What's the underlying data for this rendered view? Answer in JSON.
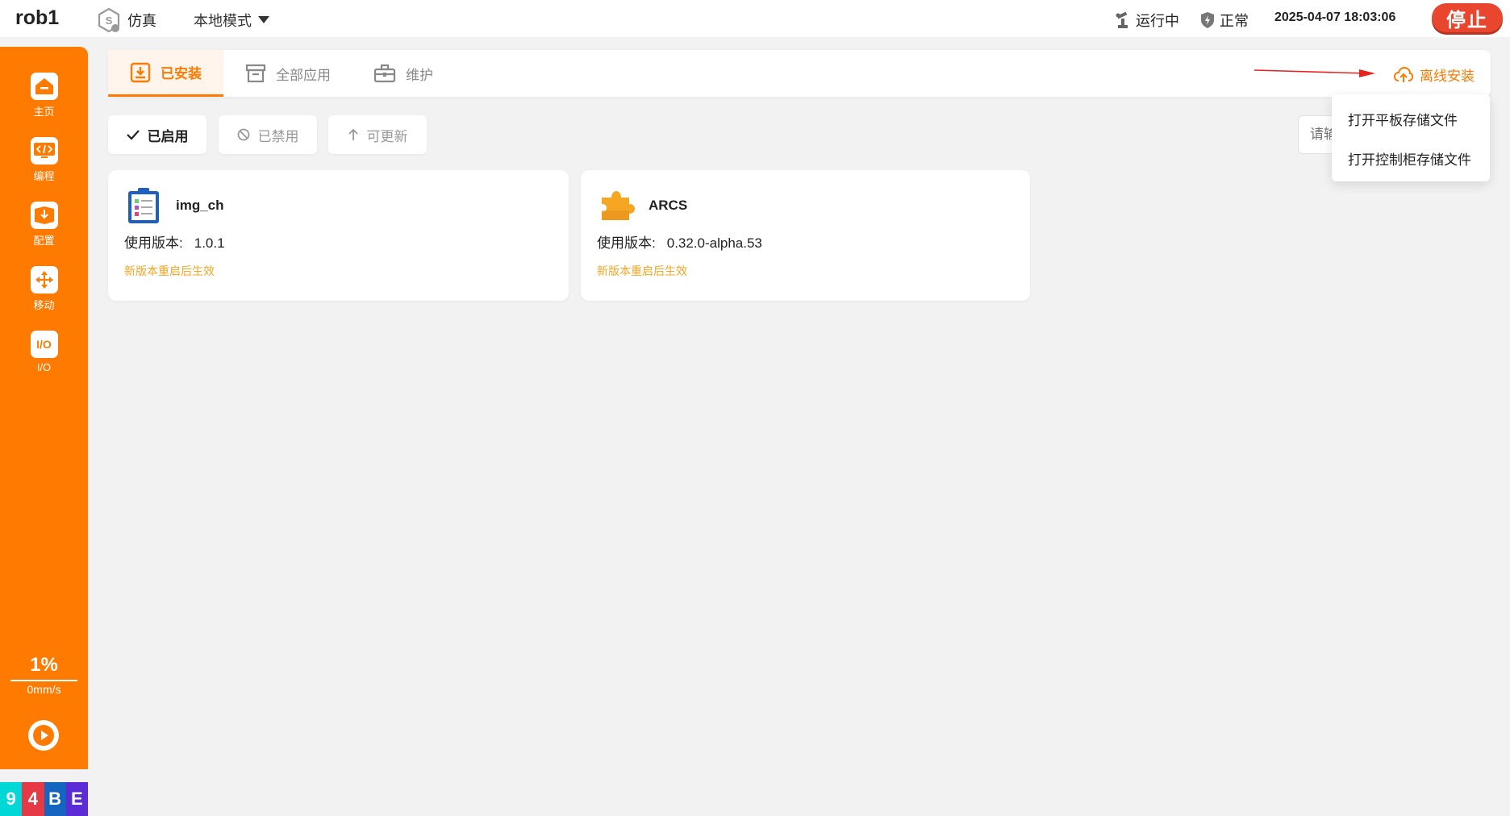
{
  "header": {
    "title": "rob1",
    "sim_label": "仿真",
    "mode_label": "本地模式",
    "run_status": "运行中",
    "safety_status": "正常",
    "datetime": "2025-04-07 18:03:06",
    "stop_label": "停止"
  },
  "sidebar": {
    "items": [
      {
        "label": "主页",
        "icon": "home-icon"
      },
      {
        "label": "编程",
        "icon": "code-icon"
      },
      {
        "label": "配置",
        "icon": "config-icon"
      },
      {
        "label": "移动",
        "icon": "move-icon"
      },
      {
        "label": "I/O",
        "icon": "io-icon",
        "glyph": "I/O"
      }
    ],
    "speed_percent": "1%",
    "speed_mm": "0mm/s",
    "code": [
      "9",
      "4",
      "B",
      "E"
    ],
    "code_colors": [
      "#00d8d8",
      "#e63946",
      "#1565c0",
      "#5b2bd6"
    ]
  },
  "tabs": {
    "items": [
      {
        "label": "已安装",
        "icon": "installed-icon"
      },
      {
        "label": "全部应用",
        "icon": "store-icon"
      },
      {
        "label": "维护",
        "icon": "toolbox-icon"
      }
    ],
    "offline_install": "离线安装"
  },
  "filters": {
    "enabled": "已启用",
    "disabled": "已禁用",
    "updatable": "可更新",
    "search_placeholder": "请输"
  },
  "dropdown": {
    "items": [
      "打开平板存储文件",
      "打开控制柜存储文件"
    ]
  },
  "apps": [
    {
      "name": "img_ch",
      "version_label": "使用版本:",
      "version": "1.0.1",
      "note": "新版本重启后生效"
    },
    {
      "name": "ARCS",
      "version_label": "使用版本:",
      "version": "0.32.0-alpha.53",
      "note": "新版本重启后生效"
    }
  ],
  "colors": {
    "accent": "#ff7a00",
    "stop": "#e8462e",
    "note": "#f5a623"
  }
}
